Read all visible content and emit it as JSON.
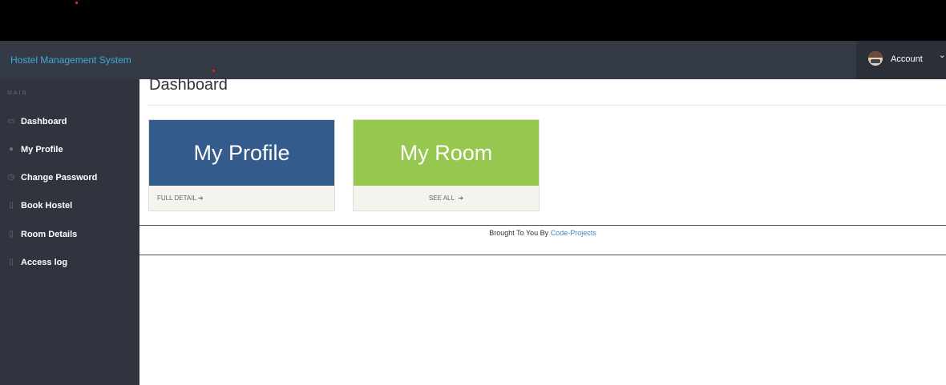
{
  "navbar": {
    "brand": "Hostel Management System",
    "account_label": "Account"
  },
  "sidebar": {
    "section_label": "MAIN",
    "items": [
      {
        "label": "Dashboard",
        "icon": "monitor-icon"
      },
      {
        "label": "My Profile",
        "icon": "user-icon"
      },
      {
        "label": "Change Password",
        "icon": "clock-icon"
      },
      {
        "label": "Book Hostel",
        "icon": "file-icon"
      },
      {
        "label": "Room Details",
        "icon": "file-icon"
      },
      {
        "label": "Access log",
        "icon": "file-icon"
      }
    ]
  },
  "main": {
    "page_title": "Dashboard",
    "cards": [
      {
        "title": "My Profile",
        "footer": "FULL DETAIL",
        "color": "#335c8c"
      },
      {
        "title": "My Room",
        "footer": "SEE ALL",
        "color": "#96c74e"
      }
    ]
  },
  "footer": {
    "text": "Brought To You By",
    "link": "Code-Projects"
  },
  "colors": {
    "navbar": "#353b46",
    "sidebar": "#2f343e",
    "brand": "#3fa9d8"
  }
}
